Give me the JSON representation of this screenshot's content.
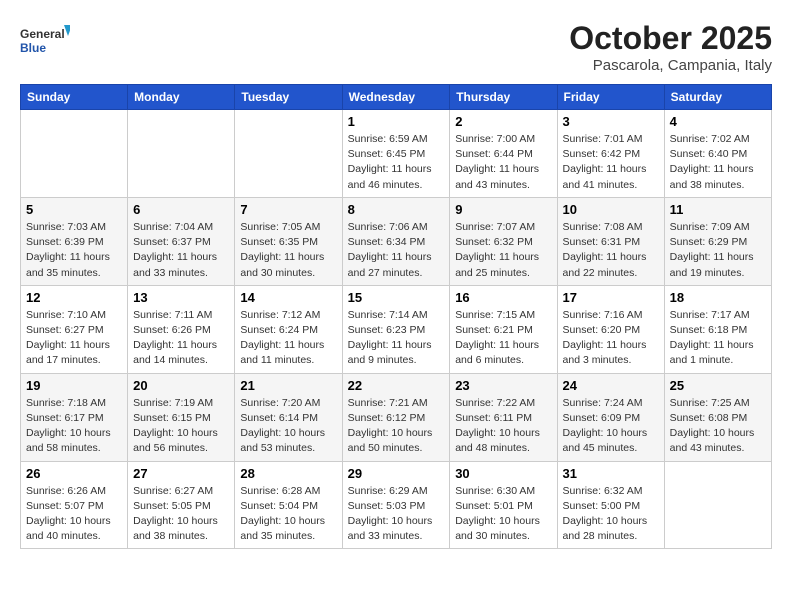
{
  "logo": {
    "general": "General",
    "blue": "Blue"
  },
  "title": "October 2025",
  "location": "Pascarola, Campania, Italy",
  "days_of_week": [
    "Sunday",
    "Monday",
    "Tuesday",
    "Wednesday",
    "Thursday",
    "Friday",
    "Saturday"
  ],
  "weeks": [
    [
      {
        "day": "",
        "info": ""
      },
      {
        "day": "",
        "info": ""
      },
      {
        "day": "",
        "info": ""
      },
      {
        "day": "1",
        "info": "Sunrise: 6:59 AM\nSunset: 6:45 PM\nDaylight: 11 hours and 46 minutes."
      },
      {
        "day": "2",
        "info": "Sunrise: 7:00 AM\nSunset: 6:44 PM\nDaylight: 11 hours and 43 minutes."
      },
      {
        "day": "3",
        "info": "Sunrise: 7:01 AM\nSunset: 6:42 PM\nDaylight: 11 hours and 41 minutes."
      },
      {
        "day": "4",
        "info": "Sunrise: 7:02 AM\nSunset: 6:40 PM\nDaylight: 11 hours and 38 minutes."
      }
    ],
    [
      {
        "day": "5",
        "info": "Sunrise: 7:03 AM\nSunset: 6:39 PM\nDaylight: 11 hours and 35 minutes."
      },
      {
        "day": "6",
        "info": "Sunrise: 7:04 AM\nSunset: 6:37 PM\nDaylight: 11 hours and 33 minutes."
      },
      {
        "day": "7",
        "info": "Sunrise: 7:05 AM\nSunset: 6:35 PM\nDaylight: 11 hours and 30 minutes."
      },
      {
        "day": "8",
        "info": "Sunrise: 7:06 AM\nSunset: 6:34 PM\nDaylight: 11 hours and 27 minutes."
      },
      {
        "day": "9",
        "info": "Sunrise: 7:07 AM\nSunset: 6:32 PM\nDaylight: 11 hours and 25 minutes."
      },
      {
        "day": "10",
        "info": "Sunrise: 7:08 AM\nSunset: 6:31 PM\nDaylight: 11 hours and 22 minutes."
      },
      {
        "day": "11",
        "info": "Sunrise: 7:09 AM\nSunset: 6:29 PM\nDaylight: 11 hours and 19 minutes."
      }
    ],
    [
      {
        "day": "12",
        "info": "Sunrise: 7:10 AM\nSunset: 6:27 PM\nDaylight: 11 hours and 17 minutes."
      },
      {
        "day": "13",
        "info": "Sunrise: 7:11 AM\nSunset: 6:26 PM\nDaylight: 11 hours and 14 minutes."
      },
      {
        "day": "14",
        "info": "Sunrise: 7:12 AM\nSunset: 6:24 PM\nDaylight: 11 hours and 11 minutes."
      },
      {
        "day": "15",
        "info": "Sunrise: 7:14 AM\nSunset: 6:23 PM\nDaylight: 11 hours and 9 minutes."
      },
      {
        "day": "16",
        "info": "Sunrise: 7:15 AM\nSunset: 6:21 PM\nDaylight: 11 hours and 6 minutes."
      },
      {
        "day": "17",
        "info": "Sunrise: 7:16 AM\nSunset: 6:20 PM\nDaylight: 11 hours and 3 minutes."
      },
      {
        "day": "18",
        "info": "Sunrise: 7:17 AM\nSunset: 6:18 PM\nDaylight: 11 hours and 1 minute."
      }
    ],
    [
      {
        "day": "19",
        "info": "Sunrise: 7:18 AM\nSunset: 6:17 PM\nDaylight: 10 hours and 58 minutes."
      },
      {
        "day": "20",
        "info": "Sunrise: 7:19 AM\nSunset: 6:15 PM\nDaylight: 10 hours and 56 minutes."
      },
      {
        "day": "21",
        "info": "Sunrise: 7:20 AM\nSunset: 6:14 PM\nDaylight: 10 hours and 53 minutes."
      },
      {
        "day": "22",
        "info": "Sunrise: 7:21 AM\nSunset: 6:12 PM\nDaylight: 10 hours and 50 minutes."
      },
      {
        "day": "23",
        "info": "Sunrise: 7:22 AM\nSunset: 6:11 PM\nDaylight: 10 hours and 48 minutes."
      },
      {
        "day": "24",
        "info": "Sunrise: 7:24 AM\nSunset: 6:09 PM\nDaylight: 10 hours and 45 minutes."
      },
      {
        "day": "25",
        "info": "Sunrise: 7:25 AM\nSunset: 6:08 PM\nDaylight: 10 hours and 43 minutes."
      }
    ],
    [
      {
        "day": "26",
        "info": "Sunrise: 6:26 AM\nSunset: 5:07 PM\nDaylight: 10 hours and 40 minutes."
      },
      {
        "day": "27",
        "info": "Sunrise: 6:27 AM\nSunset: 5:05 PM\nDaylight: 10 hours and 38 minutes."
      },
      {
        "day": "28",
        "info": "Sunrise: 6:28 AM\nSunset: 5:04 PM\nDaylight: 10 hours and 35 minutes."
      },
      {
        "day": "29",
        "info": "Sunrise: 6:29 AM\nSunset: 5:03 PM\nDaylight: 10 hours and 33 minutes."
      },
      {
        "day": "30",
        "info": "Sunrise: 6:30 AM\nSunset: 5:01 PM\nDaylight: 10 hours and 30 minutes."
      },
      {
        "day": "31",
        "info": "Sunrise: 6:32 AM\nSunset: 5:00 PM\nDaylight: 10 hours and 28 minutes."
      },
      {
        "day": "",
        "info": ""
      }
    ]
  ]
}
